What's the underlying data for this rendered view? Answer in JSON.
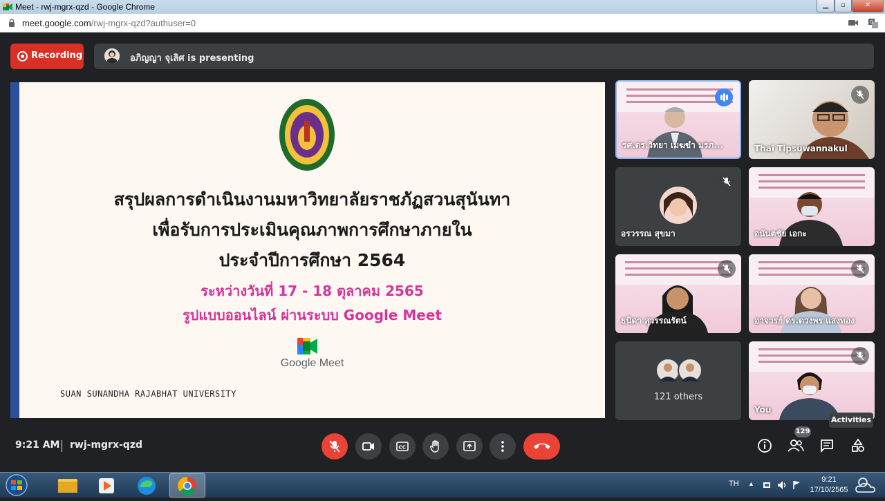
{
  "window": {
    "title": "Meet - rwj-mgrx-qzd - Google Chrome",
    "controls": [
      "minimize",
      "maximize",
      "close"
    ]
  },
  "address_bar": {
    "url_host": "meet.google.com",
    "url_path": "/rwj-mgrx-qzd?authuser=0",
    "icons": [
      "lock-icon",
      "camera-blocked-icon",
      "translate-icon"
    ]
  },
  "meet": {
    "recording_label": "Recording",
    "presenting_label": "อภิญญา จุเลิศ is presenting",
    "slide": {
      "line1": "สรุปผลการดำเนินงานมหาวิทยาลัยราชภัฏสวนสุนันทา",
      "line2": "เพื่อรับการประเมินคุณภาพการศึกษาภายใน",
      "line3": "ประจำปีการศึกษา 2564",
      "line4": "ระหว่างวันที่ 17 - 18 ตุลาคม 2565",
      "line5": "รูปแบบออนไลน์ ผ่านระบบ Google Meet",
      "logo_text": "Google Meet",
      "university": "SUAN SUNANDHA RAJABHAT UNIVERSITY",
      "accent_color": "#d8339c",
      "edge_color": "#2c4f9e"
    },
    "participants": [
      {
        "name": "รศ.ดร.วิทยา เมฆขำ มรภ...",
        "state": "speaking"
      },
      {
        "name": "Thai Tipsuwannakul",
        "state": "muted"
      },
      {
        "name": "อรวรรณ สุขมา",
        "state": "muted"
      },
      {
        "name": "อนันตชัย เอกะ",
        "state": "video"
      },
      {
        "name": "ธนิดา สุวรรณรัตน์",
        "state": "muted"
      },
      {
        "name": "อาจารย์ ดร.ดวงพร แสงทอง",
        "state": "muted"
      },
      {
        "name": "121 others",
        "state": "others"
      },
      {
        "name": "You",
        "state": "muted"
      }
    ],
    "bottom": {
      "time": "9:21 AM",
      "meeting_code": "rwj-mgrx-qzd",
      "people_count": "129",
      "tooltip": "Activities",
      "end_color": "#ea4335"
    }
  },
  "taskbar": {
    "lang": "TH",
    "clock_time": "9:21",
    "clock_date": "17/10/2565",
    "apps": [
      "explorer-icon",
      "media-player-icon",
      "edge-icon",
      "chrome-icon"
    ]
  }
}
